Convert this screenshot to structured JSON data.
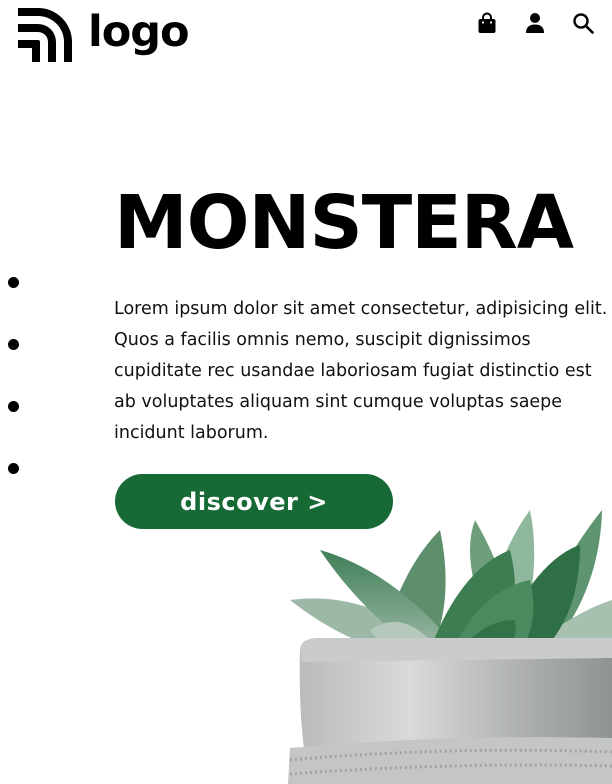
{
  "header": {
    "logo_text": "logo",
    "icons": [
      "shopping-bag-icon",
      "user-icon",
      "search-icon"
    ]
  },
  "slider": {
    "dots": 4
  },
  "hero": {
    "title": "MONSTERA",
    "description": "Lorem ipsum dolor sit amet consectetur, adipisicing elit. Quos a facilis omnis nemo, suscipit dignissimos cupiditate rec usandae laboriosam fugiat distinctio est ab voluptates aliquam sint cumque voluptas saepe incidunt laborum.",
    "cta_label": "discover >"
  },
  "colors": {
    "accent": "#176936",
    "text": "#000000",
    "background": "#ffffff"
  }
}
